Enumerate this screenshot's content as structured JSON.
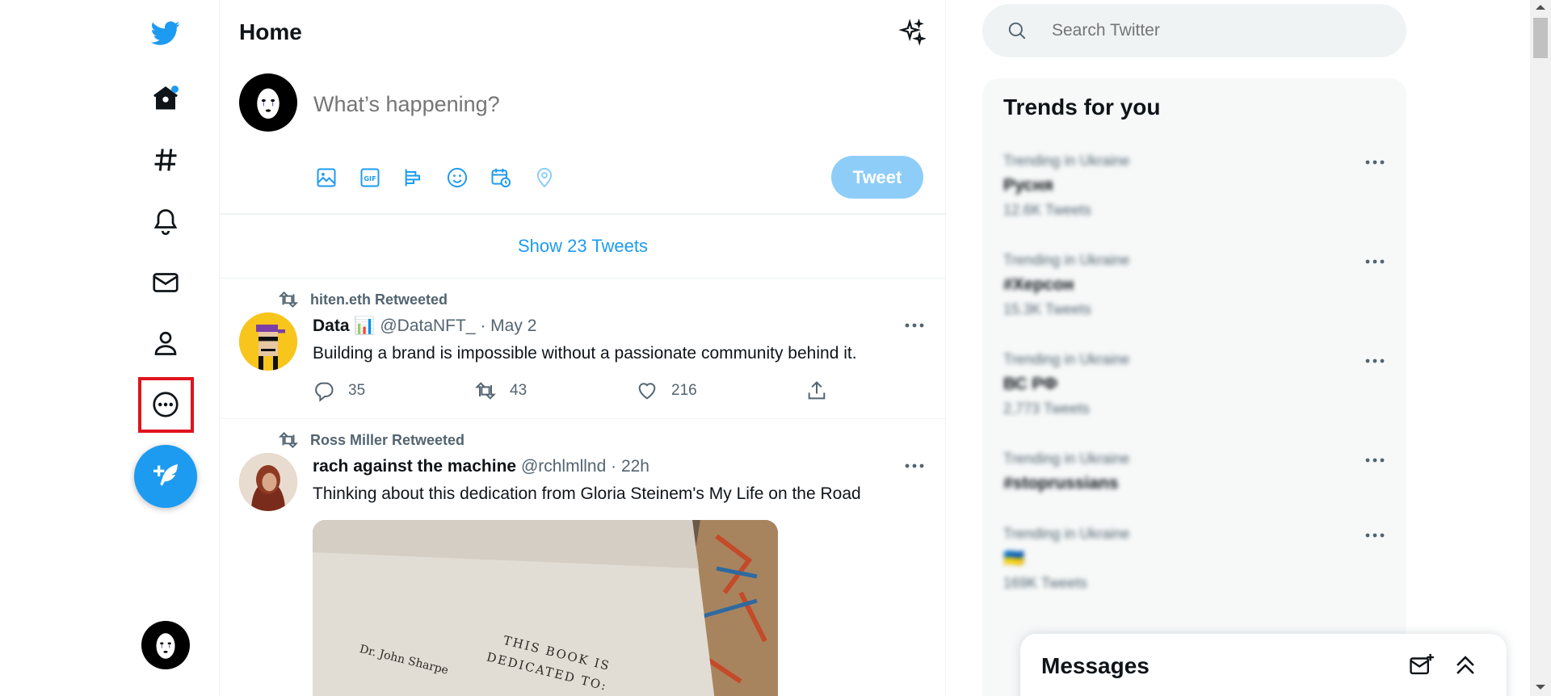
{
  "nav": {
    "items": [
      {
        "name": "twitter-logo-icon"
      },
      {
        "name": "home-icon"
      },
      {
        "name": "explore-icon"
      },
      {
        "name": "notifications-icon"
      },
      {
        "name": "messages-icon"
      },
      {
        "name": "profile-icon"
      },
      {
        "name": "more-icon"
      }
    ],
    "accent": "#1d9bf0",
    "highlight_color": "#e0141e"
  },
  "home": {
    "title": "Home",
    "composer_placeholder": "What’s happening?",
    "tweet_button": "Tweet",
    "show_tweets": "Show 23 Tweets"
  },
  "tweets": [
    {
      "retweeted_by": "hiten.eth Retweeted",
      "name": "Data 📊",
      "handle_time": "@DataNFT_ · May 2",
      "text": "Building a brand is impossible without a passionate community behind it.",
      "replies": "35",
      "retweets": "43",
      "likes": "216"
    },
    {
      "retweeted_by": "Ross Miller Retweeted",
      "name": "rach against the machine",
      "handle_time": "@rchlmllnd · 22h",
      "text": "Thinking about this dedication from Gloria Steinem's My Life on the Road",
      "image_text": [
        "THIS BOOK IS",
        "DEDICATED TO:",
        "Dr. John Sharpe"
      ]
    }
  ],
  "search": {
    "placeholder": "Search Twitter"
  },
  "trends": {
    "title": "Trends for you",
    "items": [
      {
        "meta": "Trending in Ukraine",
        "name": "Русня",
        "count": "12.6K Tweets"
      },
      {
        "meta": "Trending in Ukraine",
        "name": "#Херсон",
        "count": "15.3K Tweets"
      },
      {
        "meta": "Trending in Ukraine",
        "name": "ВС РФ",
        "count": "2,773 Tweets"
      },
      {
        "meta": "Trending in Ukraine",
        "name": "#stoprussians",
        "count": ""
      },
      {
        "meta": "Trending in Ukraine",
        "name": "🇺🇦",
        "count": "169K Tweets"
      }
    ]
  },
  "messages": {
    "title": "Messages"
  }
}
